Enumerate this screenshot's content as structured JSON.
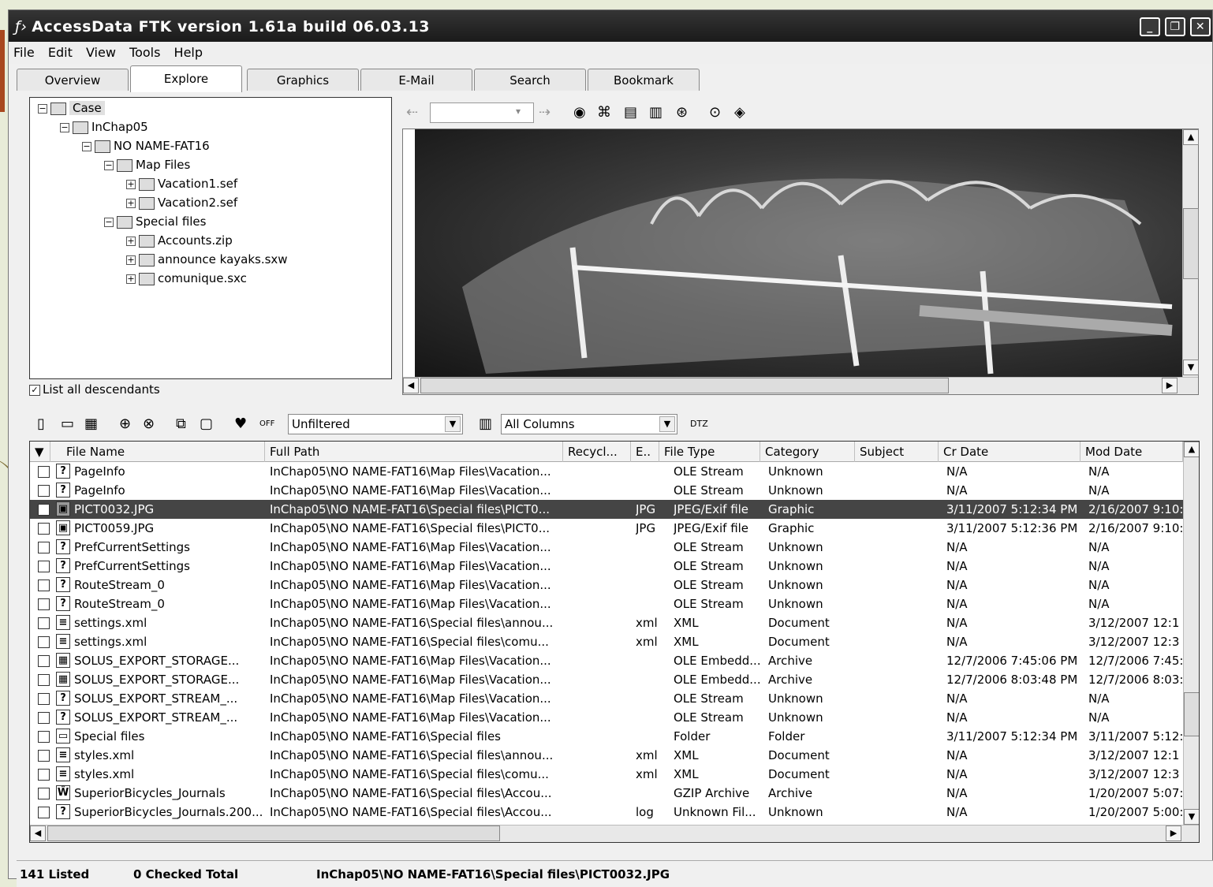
{
  "window": {
    "title": "AccessData FTK version 1.61a build 06.03.13",
    "app_icon": "ftk-icon"
  },
  "menu": [
    "File",
    "Edit",
    "View",
    "Tools",
    "Help"
  ],
  "tabs": [
    "Overview",
    "Explore",
    "Graphics",
    "E-Mail",
    "Search",
    "Bookmark"
  ],
  "active_tab": "Explore",
  "tree": [
    {
      "label": "Case",
      "level": 0,
      "expander": "−",
      "icon": "case-icon"
    },
    {
      "label": "InChap05",
      "level": 1,
      "expander": "−",
      "icon": "drive-icon"
    },
    {
      "label": "NO NAME-FAT16",
      "level": 2,
      "expander": "−",
      "icon": "partition-icon"
    },
    {
      "label": "Map Files",
      "level": 3,
      "expander": "−",
      "icon": "folder-icon"
    },
    {
      "label": "Vacation1.sef",
      "level": 4,
      "expander": "+",
      "icon": "sef-file-icon"
    },
    {
      "label": "Vacation2.sef",
      "level": 4,
      "expander": "+",
      "icon": "sef-file-icon"
    },
    {
      "label": "Special files",
      "level": 3,
      "expander": "−",
      "icon": "folder-icon"
    },
    {
      "label": "Accounts.zip",
      "level": 4,
      "expander": "+",
      "icon": "archive-icon"
    },
    {
      "label": "announce kayaks.sxw",
      "level": 4,
      "expander": "+",
      "icon": "archive-icon"
    },
    {
      "label": "comunique.sxc",
      "level": 4,
      "expander": "+",
      "icon": "archive-icon"
    }
  ],
  "list_descendants": {
    "label": "List all descendants",
    "checked": true
  },
  "filter": {
    "off_label": "OFF",
    "value": "Unfiltered"
  },
  "columns_combo": {
    "value": "All Columns"
  },
  "dtz_label": "DTZ",
  "grid": {
    "columns": [
      "File Name",
      "Full Path",
      "Recycl...",
      "E..",
      "File Type",
      "Category",
      "Subject",
      "Cr Date",
      "Mod Date"
    ],
    "rows": [
      {
        "icon": "?",
        "name": "PageInfo",
        "path": "InChap05\\NO NAME-FAT16\\Map Files\\Vacation...",
        "recycle": "",
        "ext": "",
        "type": "OLE Stream",
        "category": "Unknown",
        "subject": "",
        "cr": "N/A",
        "mod": "N/A"
      },
      {
        "icon": "?",
        "name": "PageInfo",
        "path": "InChap05\\NO NAME-FAT16\\Map Files\\Vacation...",
        "recycle": "",
        "ext": "",
        "type": "OLE Stream",
        "category": "Unknown",
        "subject": "",
        "cr": "N/A",
        "mod": "N/A"
      },
      {
        "icon": "▣",
        "name": "PICT0032.JPG",
        "path": "InChap05\\NO NAME-FAT16\\Special files\\PICT0...",
        "recycle": "",
        "ext": "JPG",
        "type": "JPEG/Exif file",
        "category": "Graphic",
        "subject": "",
        "cr": "3/11/2007 5:12:34 PM",
        "mod": "2/16/2007 9:10:",
        "selected": true
      },
      {
        "icon": "▣",
        "name": "PICT0059.JPG",
        "path": "InChap05\\NO NAME-FAT16\\Special files\\PICT0...",
        "recycle": "",
        "ext": "JPG",
        "type": "JPEG/Exif file",
        "category": "Graphic",
        "subject": "",
        "cr": "3/11/2007 5:12:36 PM",
        "mod": "2/16/2007 9:10:"
      },
      {
        "icon": "?",
        "name": "PrefCurrentSettings",
        "path": "InChap05\\NO NAME-FAT16\\Map Files\\Vacation...",
        "recycle": "",
        "ext": "",
        "type": "OLE Stream",
        "category": "Unknown",
        "subject": "",
        "cr": "N/A",
        "mod": "N/A"
      },
      {
        "icon": "?",
        "name": "PrefCurrentSettings",
        "path": "InChap05\\NO NAME-FAT16\\Map Files\\Vacation...",
        "recycle": "",
        "ext": "",
        "type": "OLE Stream",
        "category": "Unknown",
        "subject": "",
        "cr": "N/A",
        "mod": "N/A"
      },
      {
        "icon": "?",
        "name": "RouteStream_0",
        "path": "InChap05\\NO NAME-FAT16\\Map Files\\Vacation...",
        "recycle": "",
        "ext": "",
        "type": "OLE Stream",
        "category": "Unknown",
        "subject": "",
        "cr": "N/A",
        "mod": "N/A"
      },
      {
        "icon": "?",
        "name": "RouteStream_0",
        "path": "InChap05\\NO NAME-FAT16\\Map Files\\Vacation...",
        "recycle": "",
        "ext": "",
        "type": "OLE Stream",
        "category": "Unknown",
        "subject": "",
        "cr": "N/A",
        "mod": "N/A"
      },
      {
        "icon": "≡",
        "name": "settings.xml",
        "path": "InChap05\\NO NAME-FAT16\\Special files\\annou...",
        "recycle": "",
        "ext": "xml",
        "type": "XML",
        "category": "Document",
        "subject": "",
        "cr": "N/A",
        "mod": "3/12/2007 12:1"
      },
      {
        "icon": "≡",
        "name": "settings.xml",
        "path": "InChap05\\NO NAME-FAT16\\Special files\\comu...",
        "recycle": "",
        "ext": "xml",
        "type": "XML",
        "category": "Document",
        "subject": "",
        "cr": "N/A",
        "mod": "3/12/2007 12:3"
      },
      {
        "icon": "▦",
        "name": "SOLUS_EXPORT_STORAGE...",
        "path": "InChap05\\NO NAME-FAT16\\Map Files\\Vacation...",
        "recycle": "",
        "ext": "",
        "type": "OLE Embedd...",
        "category": "Archive",
        "subject": "",
        "cr": "12/7/2006 7:45:06 PM",
        "mod": "12/7/2006 7:45:"
      },
      {
        "icon": "▦",
        "name": "SOLUS_EXPORT_STORAGE...",
        "path": "InChap05\\NO NAME-FAT16\\Map Files\\Vacation...",
        "recycle": "",
        "ext": "",
        "type": "OLE Embedd...",
        "category": "Archive",
        "subject": "",
        "cr": "12/7/2006 8:03:48 PM",
        "mod": "12/7/2006 8:03:"
      },
      {
        "icon": "?",
        "name": "SOLUS_EXPORT_STREAM_...",
        "path": "InChap05\\NO NAME-FAT16\\Map Files\\Vacation...",
        "recycle": "",
        "ext": "",
        "type": "OLE Stream",
        "category": "Unknown",
        "subject": "",
        "cr": "N/A",
        "mod": "N/A"
      },
      {
        "icon": "?",
        "name": "SOLUS_EXPORT_STREAM_...",
        "path": "InChap05\\NO NAME-FAT16\\Map Files\\Vacation...",
        "recycle": "",
        "ext": "",
        "type": "OLE Stream",
        "category": "Unknown",
        "subject": "",
        "cr": "N/A",
        "mod": "N/A"
      },
      {
        "icon": "▭",
        "name": "Special files",
        "path": "InChap05\\NO NAME-FAT16\\Special files",
        "recycle": "",
        "ext": "",
        "type": "Folder",
        "category": "Folder",
        "subject": "",
        "cr": "3/11/2007 5:12:34 PM",
        "mod": "3/11/2007 5:12:"
      },
      {
        "icon": "≡",
        "name": "styles.xml",
        "path": "InChap05\\NO NAME-FAT16\\Special files\\annou...",
        "recycle": "",
        "ext": "xml",
        "type": "XML",
        "category": "Document",
        "subject": "",
        "cr": "N/A",
        "mod": "3/12/2007 12:1"
      },
      {
        "icon": "≡",
        "name": "styles.xml",
        "path": "InChap05\\NO NAME-FAT16\\Special files\\comu...",
        "recycle": "",
        "ext": "xml",
        "type": "XML",
        "category": "Document",
        "subject": "",
        "cr": "N/A",
        "mod": "3/12/2007 12:3"
      },
      {
        "icon": "Ŵ",
        "name": "SuperiorBicycles_Journals",
        "path": "InChap05\\NO NAME-FAT16\\Special files\\Accou...",
        "recycle": "",
        "ext": "",
        "type": "GZIP Archive",
        "category": "Archive",
        "subject": "",
        "cr": "N/A",
        "mod": "1/20/2007 5:07:"
      },
      {
        "icon": "?",
        "name": "SuperiorBicycles_Journals.200...",
        "path": "InChap05\\NO NAME-FAT16\\Special files\\Accou...",
        "recycle": "",
        "ext": "log",
        "type": "Unknown Fil...",
        "category": "Unknown",
        "subject": "",
        "cr": "N/A",
        "mod": "1/20/2007 5:00:"
      }
    ]
  },
  "status": {
    "listed": "141 Listed",
    "checked": "0 Checked Total",
    "path": "InChap05\\NO NAME-FAT16\\Special files\\PICT0032.JPG"
  }
}
